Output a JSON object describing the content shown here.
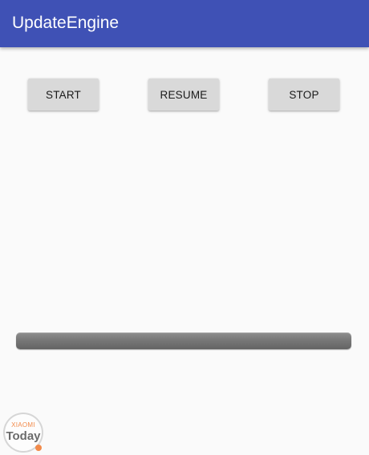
{
  "app_bar": {
    "title": "UpdateEngine",
    "color": "#3f51b5"
  },
  "buttons": {
    "start_label": "START",
    "resume_label": "RESUME",
    "stop_label": "STOP"
  },
  "progress": {
    "value_fraction": 0
  },
  "watermark": {
    "top_text": "XIAOMI",
    "bottom_text": "Today"
  }
}
